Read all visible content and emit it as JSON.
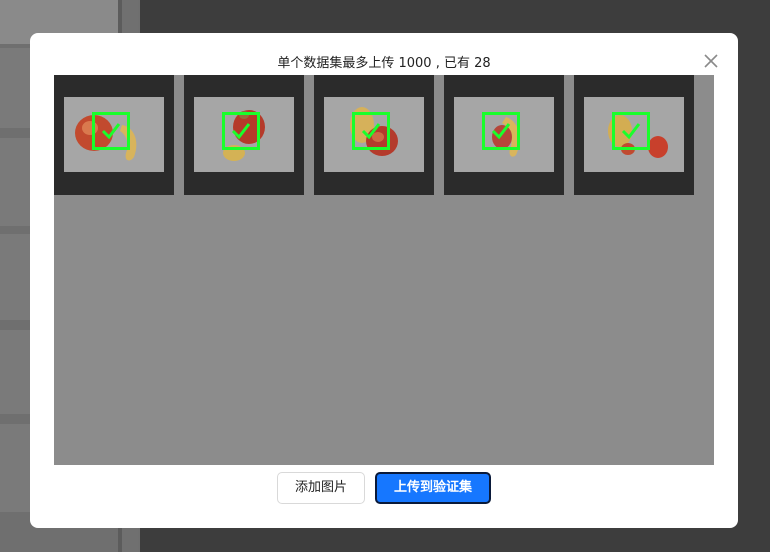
{
  "dialog": {
    "title": "单个数据集最多上传 1000 , 已有 28",
    "add_button_label": "添加图片",
    "upload_button_label": "上传到验证集"
  },
  "images": [
    {
      "name": "fruit-image-1",
      "selected": true
    },
    {
      "name": "fruit-image-2",
      "selected": true
    },
    {
      "name": "fruit-image-3",
      "selected": true
    },
    {
      "name": "fruit-image-4",
      "selected": true
    },
    {
      "name": "fruit-image-5",
      "selected": true
    }
  ],
  "colors": {
    "primary": "#1677ff",
    "check": "#19ff2b",
    "thumb_bg": "#2b2b2b",
    "gallery_bg": "#8c8c8c"
  }
}
